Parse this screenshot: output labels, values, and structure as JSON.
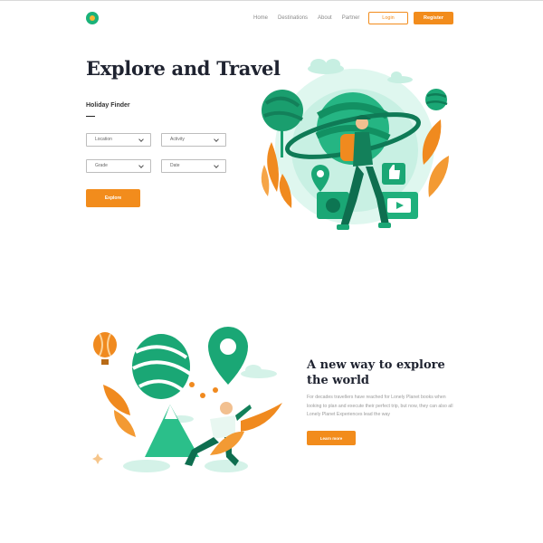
{
  "nav": {
    "items": [
      "Home",
      "Destinations",
      "About",
      "Partner"
    ],
    "login_label": "Login",
    "register_label": "Register"
  },
  "hero": {
    "title": "Explore and Travel",
    "finder_title": "Holiday Finder",
    "fields": [
      {
        "label": "Location"
      },
      {
        "label": "Activity"
      },
      {
        "label": "Grade"
      },
      {
        "label": "Date"
      }
    ],
    "explore_label": "Explore"
  },
  "section2": {
    "title": "A new way to explore the world",
    "text": "For decades travellers have reached for Lonely Planet books when looking to plan and execute their perfect trip, but now, they can also all Lonely Planet Experiences lead the way",
    "button_label": "Learn more"
  },
  "colors": {
    "accent": "#f28c1c",
    "green": "#1bb27a",
    "dark_green": "#0e6e4f",
    "light_green": "#bfeee0"
  },
  "icons": [
    "logo-icon",
    "chevron-down-icon",
    "planet-icon",
    "hiker-icon",
    "location-pin-icon",
    "hot-air-balloon-icon",
    "thumbs-up-icon",
    "play-icon",
    "camera-icon"
  ]
}
